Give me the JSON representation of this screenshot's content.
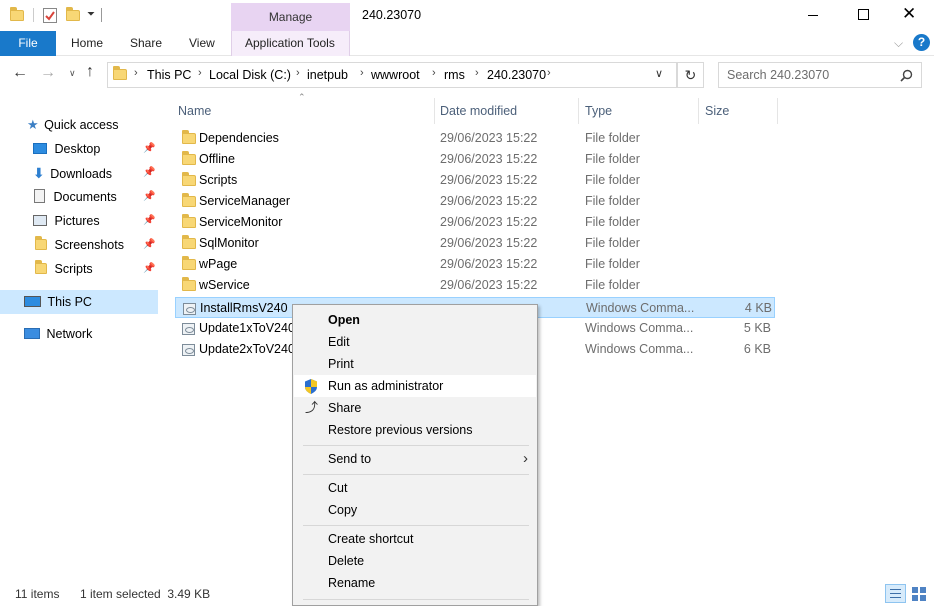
{
  "window": {
    "title": "240.23070",
    "context_tab_group": "Manage",
    "quick_access_toolbar": [
      "folder-icon",
      "properties-icon",
      "new-folder-icon",
      "customize-dropdown-icon"
    ],
    "controls": [
      "minimize",
      "maximize",
      "close"
    ]
  },
  "ribbon": {
    "tabs": [
      "File",
      "Home",
      "Share",
      "View",
      "Application Tools"
    ],
    "active_color": "#1979ca",
    "context_color": "#e8d4f2"
  },
  "address": {
    "path": [
      "This PC",
      "Local Disk (C:)",
      "inetpub",
      "wwwroot",
      "rms",
      "240.23070"
    ],
    "search_placeholder": "Search 240.23070"
  },
  "nav": {
    "quick_access": "Quick access",
    "pinned": [
      {
        "label": "Desktop",
        "icon": "desktop-icon"
      },
      {
        "label": "Downloads",
        "icon": "download-arrow-icon"
      },
      {
        "label": "Documents",
        "icon": "document-icon"
      },
      {
        "label": "Pictures",
        "icon": "pictures-icon"
      },
      {
        "label": "Screenshots",
        "icon": "folder-icon"
      },
      {
        "label": "Scripts",
        "icon": "folder-icon"
      }
    ],
    "this_pc": "This PC",
    "network": "Network"
  },
  "columns": {
    "name": "Name",
    "date": "Date modified",
    "type": "Type",
    "size": "Size"
  },
  "files": [
    {
      "name": "Dependencies",
      "date": "29/06/2023 15:22",
      "type": "File folder",
      "size": ""
    },
    {
      "name": "Offline",
      "date": "29/06/2023 15:22",
      "type": "File folder",
      "size": ""
    },
    {
      "name": "Scripts",
      "date": "29/06/2023 15:22",
      "type": "File folder",
      "size": ""
    },
    {
      "name": "ServiceManager",
      "date": "29/06/2023 15:22",
      "type": "File folder",
      "size": ""
    },
    {
      "name": "ServiceMonitor",
      "date": "29/06/2023 15:22",
      "type": "File folder",
      "size": ""
    },
    {
      "name": "SqlMonitor",
      "date": "29/06/2023 15:22",
      "type": "File folder",
      "size": ""
    },
    {
      "name": "wPage",
      "date": "29/06/2023 15:22",
      "type": "File folder",
      "size": ""
    },
    {
      "name": "wService",
      "date": "29/06/2023 15:22",
      "type": "File folder",
      "size": ""
    },
    {
      "name": "InstallRmsV240",
      "date": "",
      "type": "Windows Comma...",
      "size": "4 KB"
    },
    {
      "name": "Update1xToV240",
      "date": "",
      "type": "Windows Comma...",
      "size": "5 KB"
    },
    {
      "name": "Update2xToV240",
      "date": "",
      "type": "Windows Comma...",
      "size": "6 KB"
    }
  ],
  "context_menu": {
    "open": "Open",
    "edit": "Edit",
    "print": "Print",
    "run_as_admin": "Run as administrator",
    "share": "Share",
    "restore": "Restore previous versions",
    "send_to": "Send to",
    "cut": "Cut",
    "copy": "Copy",
    "create_shortcut": "Create shortcut",
    "delete": "Delete",
    "rename": "Rename"
  },
  "status": {
    "items": "11 items",
    "selected": "1 item selected  3.49 KB"
  }
}
